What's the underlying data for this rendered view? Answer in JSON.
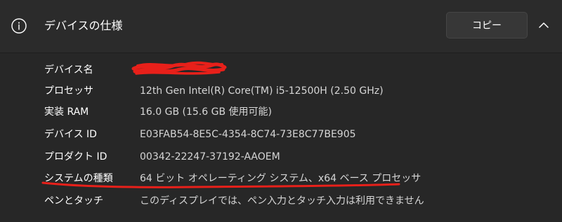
{
  "header": {
    "title": "デバイスの仕様",
    "copy_label": "コピー",
    "info_icon": "info-icon",
    "collapse_icon": "chevron-up-icon"
  },
  "specs": [
    {
      "label": "デバイス名",
      "value": ""
    },
    {
      "label": "プロセッサ",
      "value": "12th Gen Intel(R) Core(TM) i5-12500H (2.50 GHz)"
    },
    {
      "label": "実装 RAM",
      "value": "16.0 GB (15.6 GB 使用可能)"
    },
    {
      "label": "デバイス ID",
      "value": "E03FAB54-8E5C-4354-8C74-73E8C77BE905"
    },
    {
      "label": "プロダクト ID",
      "value": "00342-22247-37192-AAOEM"
    },
    {
      "label": "システムの種類",
      "value": "64 ビット オペレーティング システム、x64 ベース プロセッサ"
    },
    {
      "label": "ペンとタッチ",
      "value": "このディスプレイでは、ペン入力とタッチ入力は利用できません"
    }
  ],
  "colors": {
    "background": "#272727",
    "header_background": "#2b2b2b",
    "annotation": "#e8201a"
  }
}
